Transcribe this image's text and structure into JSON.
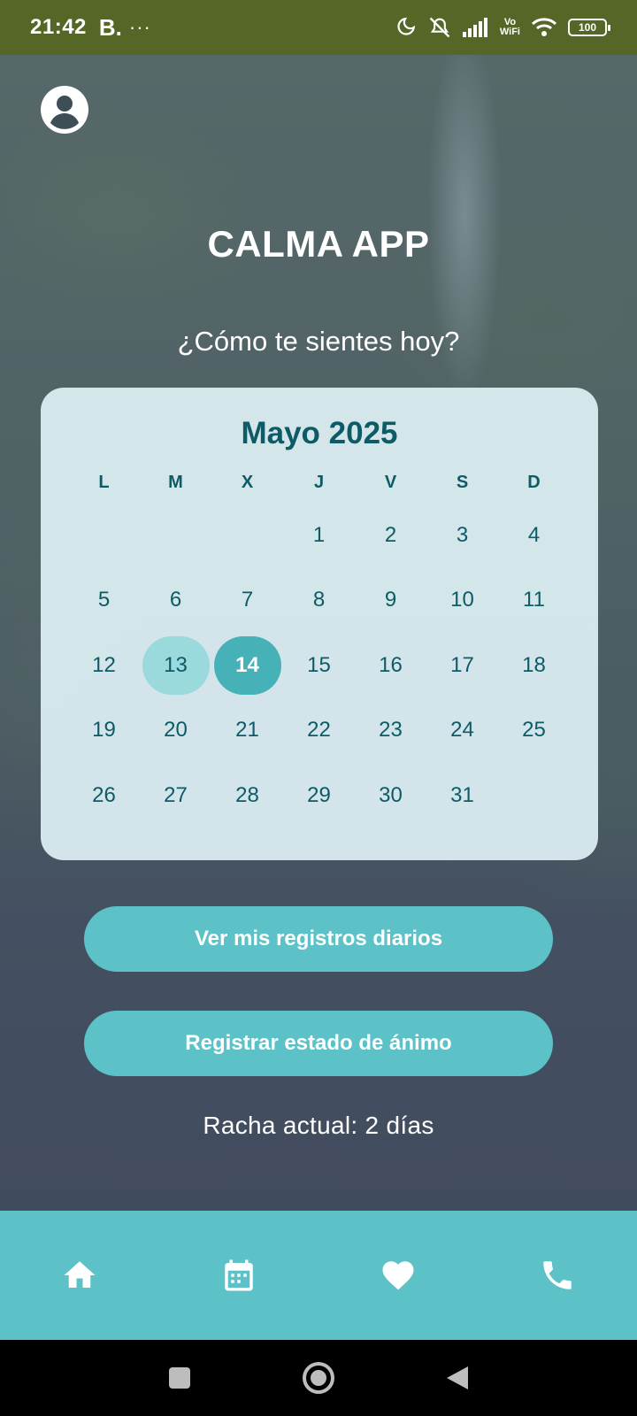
{
  "status_bar": {
    "time": "21:42",
    "carrier": "B.",
    "dots": "···",
    "vowifi_top": "Vo",
    "vowifi_bottom": "WiFi",
    "battery": "100",
    "background": "#556627"
  },
  "header": {
    "title": "CALMA APP",
    "question": "¿Cómo te sientes hoy?"
  },
  "calendar": {
    "title": "Mayo 2025",
    "weekdays": [
      "L",
      "M",
      "X",
      "J",
      "V",
      "S",
      "D"
    ],
    "leading_blanks": 3,
    "days": [
      "1",
      "2",
      "3",
      "4",
      "5",
      "6",
      "7",
      "8",
      "9",
      "10",
      "11",
      "12",
      "13",
      "14",
      "15",
      "16",
      "17",
      "18",
      "19",
      "20",
      "21",
      "22",
      "23",
      "24",
      "25",
      "26",
      "27",
      "28",
      "29",
      "30",
      "31"
    ],
    "highlighted_day": "13",
    "selected_day": "14"
  },
  "buttons": {
    "records": "Ver mis registros diarios",
    "mood": "Registrar estado de ánimo"
  },
  "streak": "Racha actual: 2 días",
  "bottom_nav": {
    "items": [
      "home-icon",
      "calendar-icon",
      "heart-icon",
      "phone-icon"
    ]
  },
  "colors": {
    "accent": "#5cc2c8",
    "selected": "#46b2b8",
    "highlight": "#9ad9dc",
    "calendar_text": "#0d5b66"
  }
}
